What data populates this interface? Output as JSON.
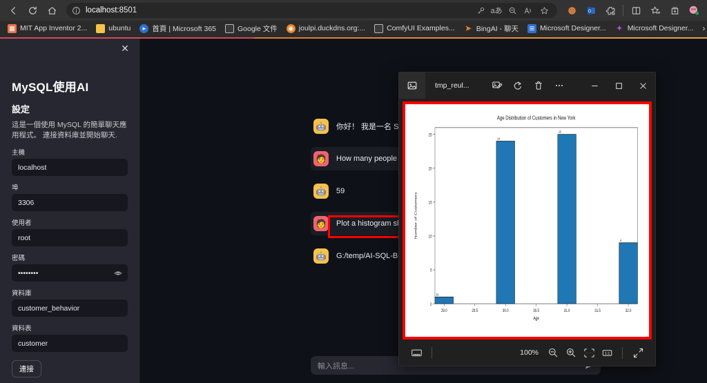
{
  "browser": {
    "nav": {
      "back_icon": "arrow-left-icon",
      "reload_icon": "reload-icon",
      "home_icon": "home-icon"
    },
    "omnibox": {
      "info_icon": "info-circle-icon",
      "url_host": "localhost",
      "url_port": ":8501",
      "icons": [
        "key-icon",
        "translate-icon",
        "zoom-out-icon",
        "read-aloud-icon",
        "favorite-star-icon"
      ]
    },
    "toolbar_icons": [
      "cookie-icon",
      "outlook-icon",
      "extensions-icon",
      "split-screen-icon",
      "add-favorite-icon",
      "collections-icon",
      "profile-icon"
    ],
    "bookmarks": [
      {
        "label": "MIT App Inventor 2...",
        "icon": "app-inventor-icon",
        "color": "#e8744a"
      },
      {
        "label": "ubuntu",
        "icon": "folder-icon",
        "color": "#f3c34a"
      },
      {
        "label": "首頁 | Microsoft 365",
        "icon": "microsoft365-icon",
        "color": "#2f6fd0"
      },
      {
        "label": "Google 文件",
        "icon": "document-icon",
        "color": "#bdbdbd"
      },
      {
        "label": "joulpi.duckdns.org:...",
        "icon": "duckdns-icon",
        "color": "#e8862a"
      },
      {
        "label": "ComfyUI Examples...",
        "icon": "document-icon",
        "color": "#bdbdbd"
      },
      {
        "label": "BingAI - 聊天",
        "icon": "bing-icon",
        "color": "#e8862a"
      },
      {
        "label": "Microsoft Designer...",
        "icon": "ms-squares-icon",
        "color": "#2f6fd0"
      },
      {
        "label": "Microsoft Designer...",
        "icon": "designer-icon",
        "color": "#9b4fd0"
      }
    ],
    "bookmarks_overflow": "›"
  },
  "sidebar": {
    "close_icon": "close-icon",
    "title": "MySQL使用AI",
    "section": "設定",
    "description": "這是一個使用 MySQL 的簡單聊天應用程式。 連接資料庫並開始聊天.",
    "fields": [
      {
        "label": "主機",
        "value": "localhost",
        "name": "host-field"
      },
      {
        "label": "埠",
        "value": "3306",
        "name": "port-field"
      },
      {
        "label": "使用者",
        "value": "root",
        "name": "user-field"
      },
      {
        "label": "密碼",
        "value": "••••••••",
        "name": "password-field",
        "eye_icon": "eye-icon"
      },
      {
        "label": "資料庫",
        "value": "customer_behavior",
        "name": "database-field"
      },
      {
        "label": "資料表",
        "value": "customer",
        "name": "table-field"
      }
    ],
    "connect_label": "連接"
  },
  "chat": {
    "messages": [
      {
        "role": "assistant",
        "avatar": "robot-icon",
        "text": "你好！ 我是一名 SQL 助..."
      },
      {
        "role": "user",
        "avatar": "person-icon",
        "text": "How many people are in..."
      },
      {
        "role": "assistant",
        "avatar": "robot-icon",
        "text": "59"
      },
      {
        "role": "user",
        "avatar": "person-icon",
        "text": "Plot a histogram showing..."
      },
      {
        "role": "assistant",
        "avatar": "robot-icon",
        "text": "G:/temp/AI-SQL-Brain-Ap..."
      }
    ],
    "input_placeholder": "輸入訊息...",
    "send_icon": "send-icon"
  },
  "viewer": {
    "app_icon": "photos-icon",
    "filename": "tmp_reul...",
    "tools": [
      {
        "name": "edit-image-icon"
      },
      {
        "name": "rotate-icon"
      },
      {
        "name": "delete-icon"
      },
      {
        "name": "more-options-icon"
      }
    ],
    "window_buttons": [
      {
        "name": "minimize-button",
        "glyph": "─"
      },
      {
        "name": "maximize-button",
        "glyph": "☐"
      },
      {
        "name": "close-button",
        "glyph": "✕"
      }
    ],
    "bottom": {
      "filmstrip_icon": "filmstrip-icon",
      "zoom_level": "100%",
      "zoom_out_icon": "zoom-out-icon",
      "zoom_in_icon": "zoom-in-icon",
      "fit-to-window_icon": "fit-to-window-icon",
      "actual-size_icon": "actual-size-icon",
      "fullscreen_icon": "fullscreen-icon"
    }
  },
  "highlight_color": "#ff0000",
  "chart_data": {
    "type": "bar",
    "title": "Age Distribution of Customers in New York",
    "xlabel": "Age",
    "ylabel": "Number of Customers",
    "x": [
      29.0,
      30.0,
      31.0,
      32.0
    ],
    "categories": [
      "29",
      "30",
      "31",
      "32"
    ],
    "values": [
      1,
      24,
      25,
      9
    ],
    "bar_labels": [
      "29",
      "24",
      "25",
      "9"
    ],
    "bar_color": "#1f77b4",
    "bar_edge_color": "#1a1a1a",
    "bar_width": 0.3,
    "xlim": [
      28.85,
      32.15
    ],
    "ylim": [
      0,
      26
    ],
    "xticks": [
      "29.0",
      "29.5",
      "30.0",
      "30.5",
      "31.0",
      "31.5",
      "32.0"
    ],
    "xtick_values": [
      29.0,
      29.5,
      30.0,
      30.5,
      31.0,
      31.5,
      32.0
    ],
    "yticks": [
      "0",
      "5",
      "10",
      "15",
      "20",
      "25"
    ],
    "ytick_values": [
      0,
      5,
      10,
      15,
      20,
      25
    ],
    "grid": false,
    "legend": null,
    "facecolor": "#ffffff"
  }
}
